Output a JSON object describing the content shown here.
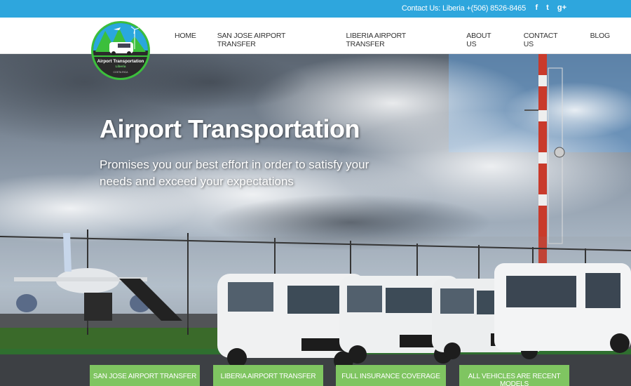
{
  "topbar": {
    "contact_text": "Contact Us: Liberia +(506) 8526-8465",
    "social": [
      {
        "icon": "facebook-icon",
        "glyph": "f"
      },
      {
        "icon": "twitter-icon",
        "glyph": "t"
      },
      {
        "icon": "google-plus-icon",
        "glyph": "g+"
      }
    ]
  },
  "logo": {
    "line1": "Airport Transportation",
    "line2": "Liberia",
    "line3": "COSTA RICA"
  },
  "nav": {
    "items": [
      {
        "label": "HOME"
      },
      {
        "label": "SAN JOSE AIRPORT TRANSFER"
      },
      {
        "label": "LIBERIA AIRPORT TRANSFER"
      },
      {
        "label": "ABOUT US"
      },
      {
        "label": "CONTACT US"
      },
      {
        "label": "BLOG"
      }
    ]
  },
  "hero": {
    "title": "Airport Transportation",
    "subtitle": "Promises you our best effort in order to satisfy your needs and exceed your expectations"
  },
  "features": [
    {
      "label": "SAN JOSE AIRPORT TRANSFER"
    },
    {
      "label": "LIBERIA AIRPORT TRANSFER"
    },
    {
      "label": "FULL INSURANCE COVERAGE"
    },
    {
      "label": "ALL VEHICLES ARE RECENT MODELS"
    }
  ],
  "colors": {
    "topbar": "#2ea6dd",
    "feature": "#7fc561",
    "logo_ring": "#3cbf3c"
  }
}
